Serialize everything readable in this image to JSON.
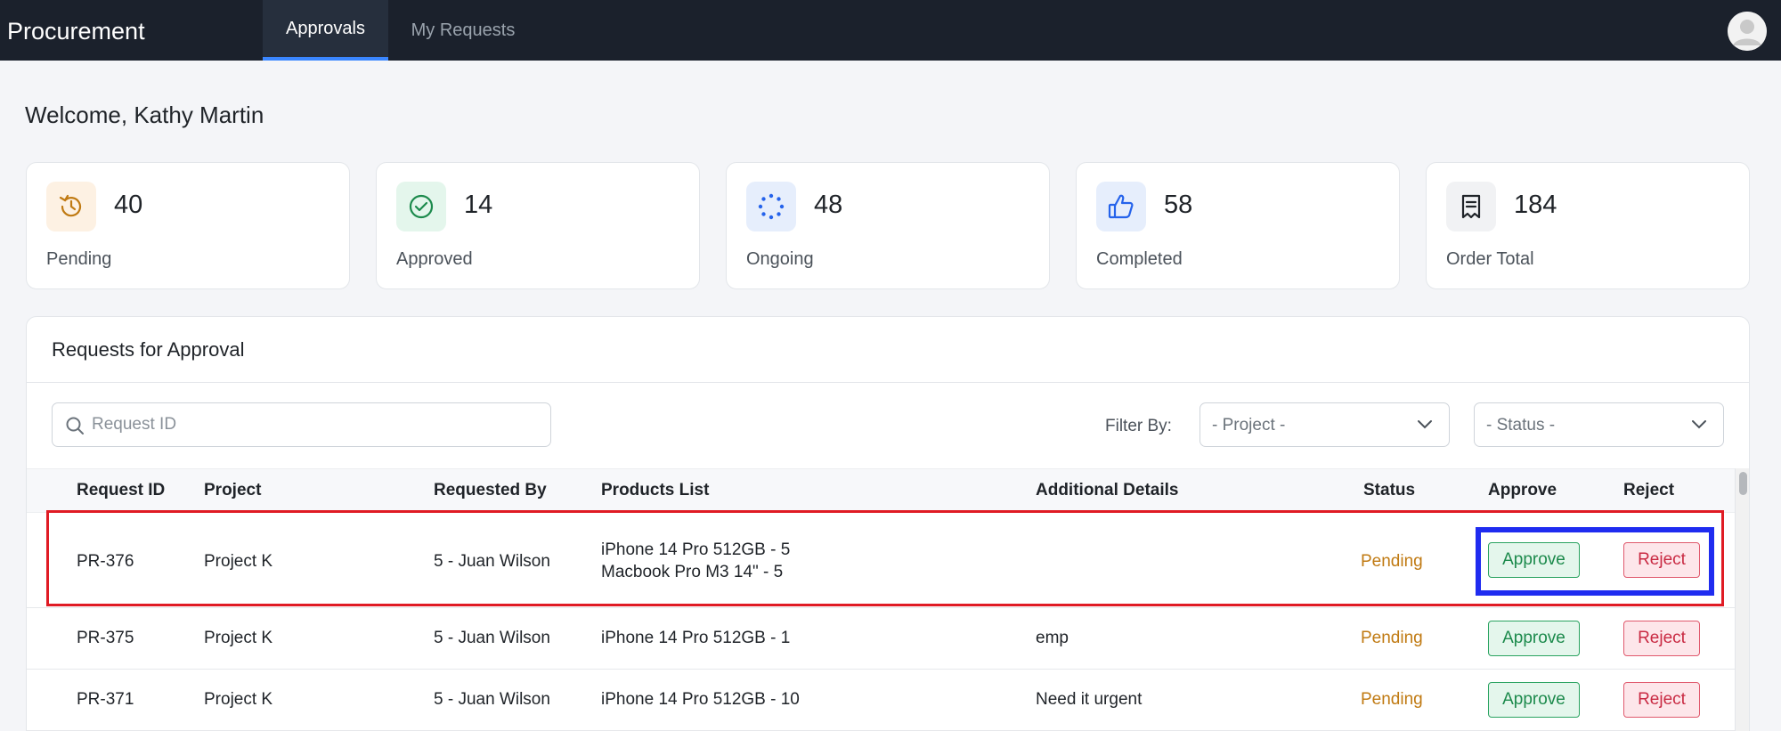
{
  "app": {
    "brand": "Procurement"
  },
  "nav": {
    "tabs": [
      {
        "label": "Approvals",
        "active": true
      },
      {
        "label": "My Requests",
        "active": false
      }
    ]
  },
  "welcome": "Welcome, Kathy Martin",
  "stats": [
    {
      "value": "40",
      "label": "Pending",
      "icon": "history-icon",
      "color": "#c07a12",
      "bg": "#fdf1e3"
    },
    {
      "value": "14",
      "label": "Approved",
      "icon": "check-circle-icon",
      "color": "#1c8a4c",
      "bg": "#e4f6ec"
    },
    {
      "value": "48",
      "label": "Ongoing",
      "icon": "loading-dots-icon",
      "color": "#2563eb",
      "bg": "#e6eefc"
    },
    {
      "value": "58",
      "label": "Completed",
      "icon": "thumbs-up-icon",
      "color": "#2563eb",
      "bg": "#e6eefc"
    },
    {
      "value": "184",
      "label": "Order Total",
      "icon": "receipt-icon",
      "color": "#1f2328",
      "bg": "#f1f2f4"
    }
  ],
  "panel": {
    "title": "Requests for Approval",
    "search_placeholder": "Request ID",
    "filter_label": "Filter By:",
    "project_select": "- Project -",
    "status_select": "- Status -"
  },
  "table": {
    "columns": [
      "Request ID",
      "Project",
      "Requested By",
      "Products List",
      "Additional Details",
      "Status",
      "Approve",
      "Reject"
    ],
    "rows": [
      {
        "id": "PR-376",
        "project": "Project K",
        "requested_by": "5 - Juan Wilson",
        "products": [
          "iPhone 14 Pro 512GB - 5",
          "Macbook Pro M3 14\" - 5"
        ],
        "details": "",
        "status": "Pending",
        "approve": "Approve",
        "reject": "Reject"
      },
      {
        "id": "PR-375",
        "project": "Project K",
        "requested_by": "5 - Juan Wilson",
        "products": [
          "iPhone 14 Pro 512GB - 1"
        ],
        "details": "emp",
        "status": "Pending",
        "approve": "Approve",
        "reject": "Reject"
      },
      {
        "id": "PR-371",
        "project": "Project K",
        "requested_by": "5 - Juan Wilson",
        "products": [
          "iPhone 14 Pro 512GB - 10"
        ],
        "details": "Need it urgent",
        "status": "Pending",
        "approve": "Approve",
        "reject": "Reject"
      }
    ]
  },
  "colors": {
    "nav_bg": "#1b212c",
    "accent": "#3a86ff",
    "pending": "#c07a12",
    "approve": "#1c8a4c",
    "reject": "#c92a43",
    "highlight_row": "#e01b24",
    "highlight_actions": "#1f2cf0"
  }
}
